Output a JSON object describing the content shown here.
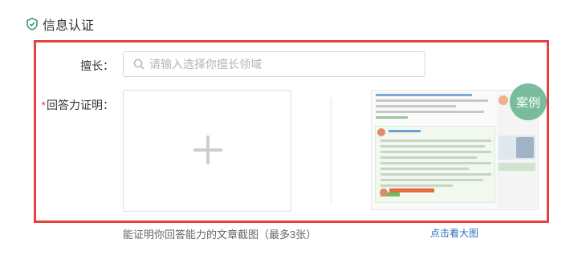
{
  "section": {
    "title": "信息认证",
    "icon": "shield-check-icon"
  },
  "form": {
    "expertise": {
      "label": "擅长：",
      "placeholder": "请输入选择你擅长领域",
      "value": ""
    },
    "answer_proof": {
      "required_mark": "*",
      "label": "回答力证明：",
      "upload_icon": "plus-icon",
      "hint": "能证明你回答能力的文章截图（最多3张）"
    },
    "example": {
      "badge": "案例",
      "view_link": "点击看大图"
    }
  },
  "colors": {
    "highlight_border": "#e8413d",
    "accent_green": "#60b28c",
    "link_blue": "#2f6fb7",
    "required_red": "#e8413d"
  }
}
